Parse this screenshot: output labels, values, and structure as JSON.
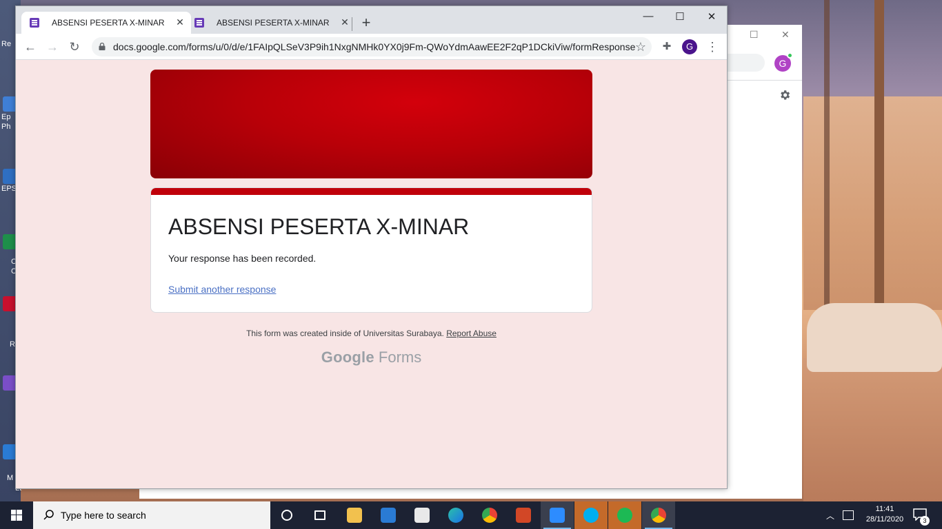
{
  "desktop": {
    "icon_labels": [
      "Re",
      "Ep",
      "Ph",
      "EPS",
      "C",
      "C",
      "R",
      "M",
      "Lt"
    ]
  },
  "background_window": {
    "avatar_letter": "G"
  },
  "browser": {
    "tabs": [
      {
        "title": "ABSENSI PESERTA X-MINAR",
        "active": true
      },
      {
        "title": "ABSENSI PESERTA X-MINAR",
        "active": false
      }
    ],
    "url": "docs.google.com/forms/u/0/d/e/1FAIpQLSeV3P9ih1NxgNMHk0YX0j9Fm-QWoYdmAawEE2F2qP1DCkiViw/formResponse",
    "profile_letter": "G"
  },
  "form": {
    "title": "ABSENSI PESERTA X-MINAR",
    "message": "Your response has been recorded.",
    "link_label": "Submit another response",
    "footer_text": "This form was created inside of Universitas Surabaya.",
    "report_label": "Report Abuse",
    "brand_google": "Google",
    "brand_forms": "Forms"
  },
  "taskbar": {
    "search_placeholder": "Type here to search",
    "time": "11:41",
    "date": "28/11/2020",
    "notification_count": "3",
    "apps": [
      "task-view",
      "file-explorer",
      "mail",
      "store",
      "edge",
      "chrome",
      "powerpoint",
      "zoom",
      "skype",
      "spotify",
      "chrome-profile"
    ]
  },
  "colors": {
    "brand_red": "#c0000a",
    "page_bg": "#f8e5e5",
    "link": "#4a70c4",
    "taskbar": "#1c2233"
  }
}
